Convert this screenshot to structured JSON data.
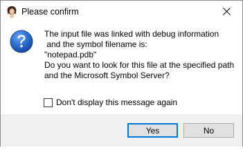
{
  "window": {
    "title": "Please confirm",
    "app_icon": "notepad-user-avatar-icon",
    "close_icon": "close-icon"
  },
  "dialog": {
    "icon": "question-icon",
    "message_lines": [
      "The input file was linked with debug information",
      " and the symbol filename is:",
      "\"notepad.pdb\"",
      "Do you want to look for this file at the specified path",
      "and the Microsoft Symbol Server?"
    ],
    "checkbox": {
      "label": "Don't display this message again",
      "checked": false
    }
  },
  "buttons": {
    "yes": "Yes",
    "no": "No"
  },
  "colors": {
    "accent": "#0078d7",
    "footer_bg": "#f0f0f0",
    "button_bg": "#e1e1e1",
    "question_icon_blue": "#1f5fbf"
  }
}
